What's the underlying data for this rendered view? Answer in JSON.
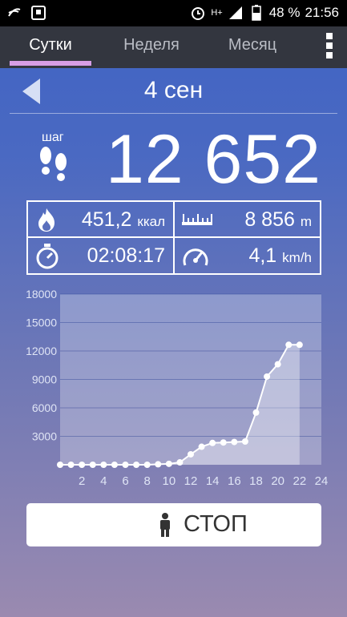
{
  "status_bar": {
    "network": "H+",
    "battery": "48 %",
    "time": "21:56",
    "icons": [
      "swiftkey-icon",
      "message-icon",
      "alarm-icon",
      "signal-icon",
      "battery-icon"
    ]
  },
  "tabs": [
    {
      "label": "Сутки",
      "active": true
    },
    {
      "label": "Неделя",
      "active": false
    },
    {
      "label": "Месяц",
      "active": false
    }
  ],
  "date": "4 сен",
  "steps": {
    "label": "шаг",
    "value": "12 652"
  },
  "stats": {
    "calories": {
      "value": "451,2",
      "unit": "ккал"
    },
    "distance": {
      "value": "8 856",
      "unit": "m"
    },
    "duration": {
      "value": "02:08:17"
    },
    "speed": {
      "value": "4,1",
      "unit": "km/h"
    }
  },
  "chart_data": {
    "type": "area",
    "ylim": [
      0,
      18000
    ],
    "xlim": [
      0,
      24
    ],
    "y_ticks": [
      "18000",
      "15000",
      "12000",
      "9000",
      "6000",
      "3000"
    ],
    "x_ticks": [
      "2",
      "4",
      "6",
      "8",
      "10",
      "12",
      "14",
      "16",
      "18",
      "20",
      "22",
      "24"
    ],
    "x": [
      0,
      1,
      2,
      3,
      4,
      5,
      6,
      7,
      8,
      9,
      10,
      11,
      12,
      13,
      14,
      15,
      16,
      17,
      18,
      19,
      20,
      21,
      22
    ],
    "values": [
      0,
      0,
      0,
      0,
      0,
      0,
      0,
      0,
      0,
      50,
      100,
      250,
      1100,
      1900,
      2300,
      2350,
      2400,
      2450,
      5500,
      9300,
      10600,
      12650,
      12650
    ],
    "grid": true
  },
  "stop_button": {
    "label": "СТОП"
  },
  "colors": {
    "tab_underline": "#d79ee6",
    "tab_bar": "#33363f"
  }
}
